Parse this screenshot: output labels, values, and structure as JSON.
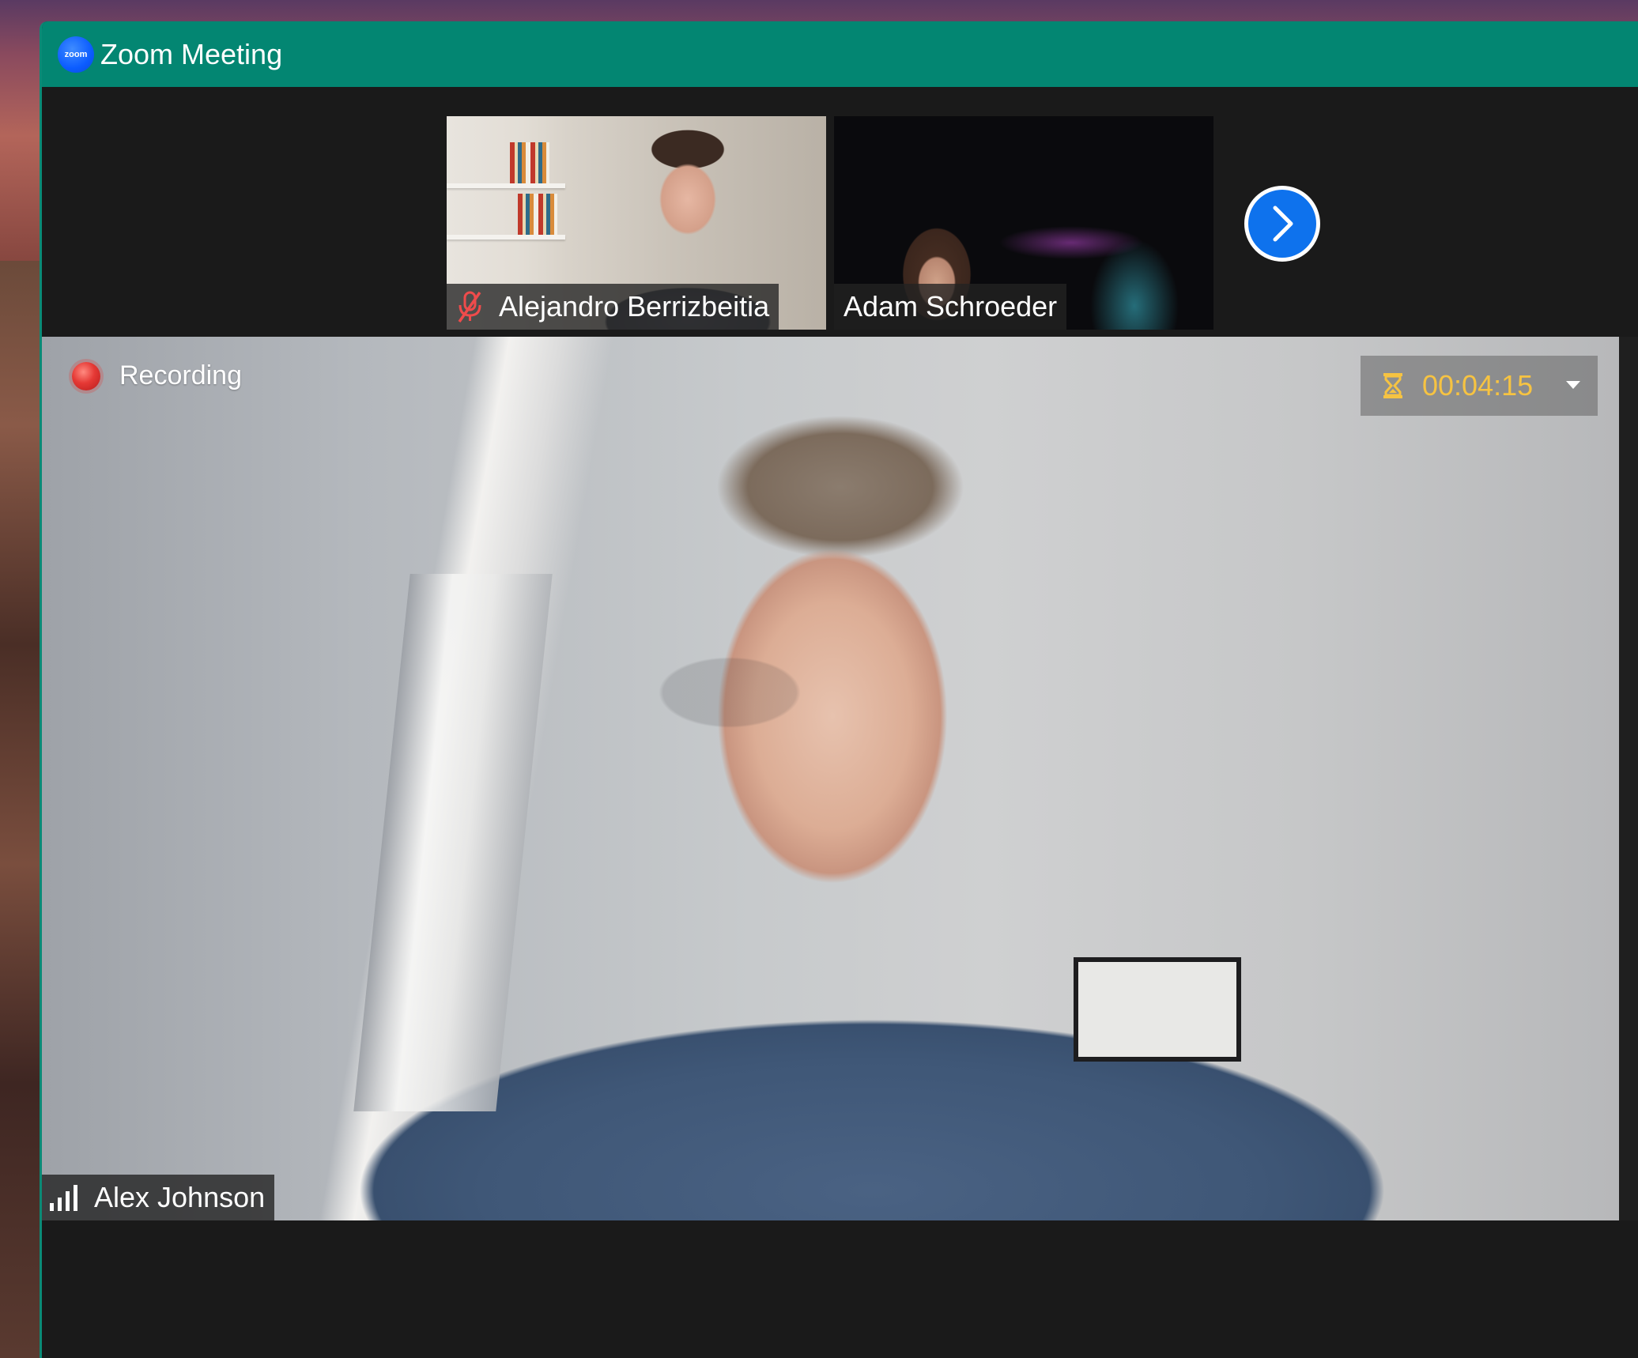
{
  "window": {
    "title": "Zoom Meeting",
    "app_logo_text": "zoom"
  },
  "gallery": {
    "participants": [
      {
        "name": "Alejandro Berrizbeitia",
        "muted": true
      },
      {
        "name": "Adam Schroeder",
        "muted": false
      }
    ]
  },
  "speaker": {
    "name": "Alex Johnson",
    "recording_label": "Recording",
    "timer": "00:04:15"
  },
  "colors": {
    "titlebar": "#038672",
    "recording": "#e53935",
    "timer_text": "#f6c342",
    "next_button": "#0e72ed"
  },
  "icons": {
    "logo": "zoom-logo-icon",
    "muted": "mic-muted-icon",
    "next": "chevron-right-icon",
    "recording": "recording-dot-icon",
    "timer": "hourglass-icon",
    "dropdown": "caret-down-icon",
    "signal": "signal-bars-icon"
  }
}
